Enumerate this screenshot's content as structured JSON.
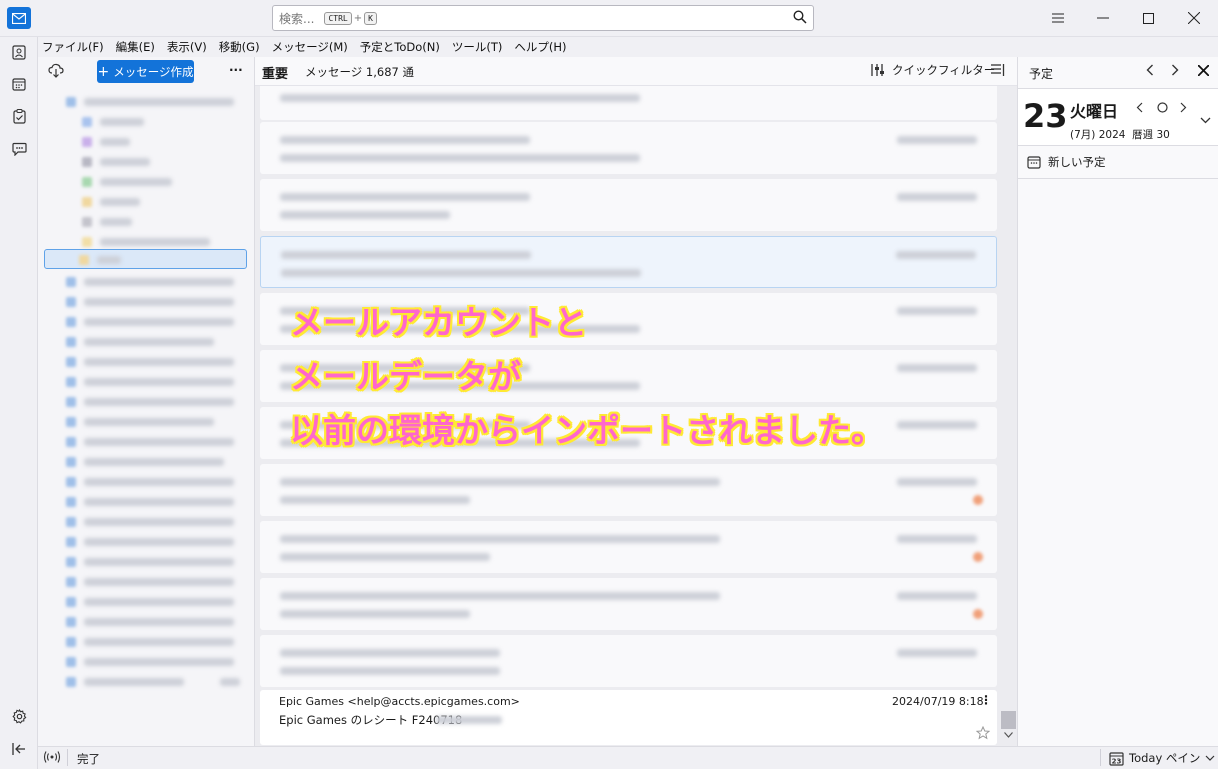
{
  "titlebar": {
    "search_placeholder": "検索...",
    "search_shortcut_key1": "CTRL",
    "search_shortcut_plus": "+",
    "search_shortcut_key2": "K"
  },
  "menubar": {
    "items": [
      "ファイル(F)",
      "編集(E)",
      "表示(V)",
      "移動(G)",
      "メッセージ(M)",
      "予定とToDo(N)",
      "ツール(T)",
      "ヘルプ(H)"
    ]
  },
  "folderpane": {
    "compose_label": "メッセージ作成",
    "more_label": "···"
  },
  "threadpane": {
    "folder_name": "重要",
    "message_count_label": "メッセージ 1,687 通",
    "quick_filter_label": "クイックフィルター"
  },
  "last_message": {
    "sender": "Epic Games <help@accts.epicgames.com>",
    "date": "2024/07/19 8:18",
    "subject": "Epic Games のレシート F240718"
  },
  "overlay": {
    "line1": "メールアカウントと",
    "line2": "メールデータが",
    "line3": "以前の環境からインポートされました。"
  },
  "todaypane": {
    "title": "予定",
    "day_number": "23",
    "weekday": "火曜日",
    "month_year_week": "(7月) 2024  暦週 30",
    "new_event_label": "新しい予定"
  },
  "statusbar": {
    "status_text": "完了",
    "today_pane_label": "Today ペイン"
  },
  "colors": {
    "accent": "#1373d9",
    "overlay_text": "#ff66cc",
    "overlay_outline": "#ffe933"
  }
}
